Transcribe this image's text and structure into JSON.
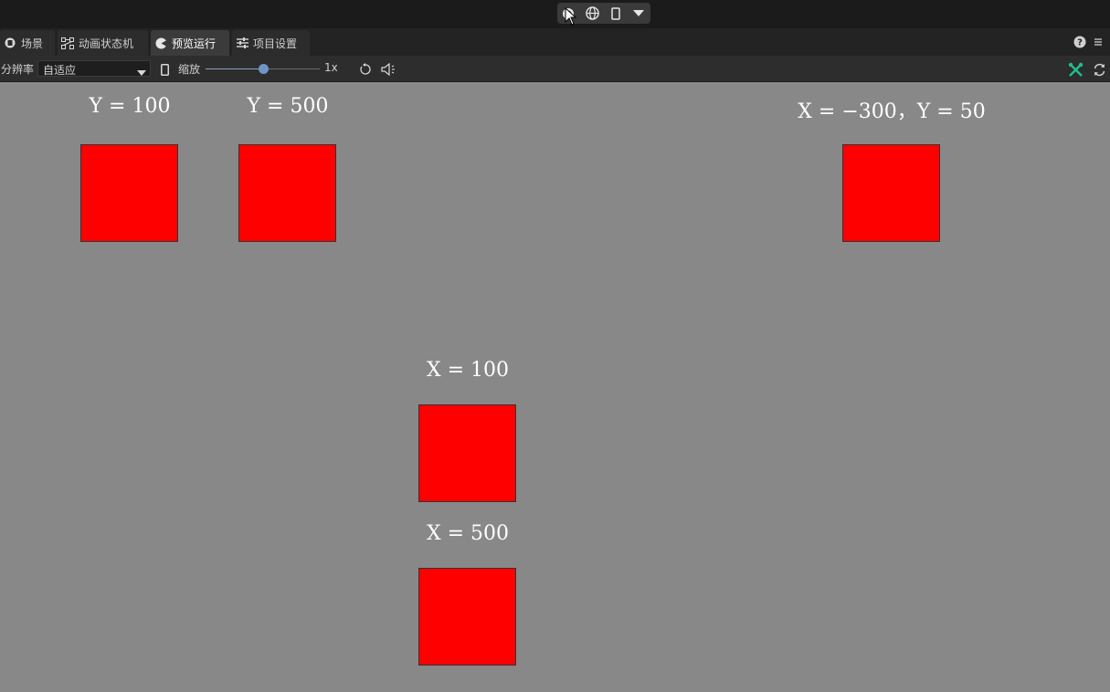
{
  "colors": {
    "canvas_bg": "#888888",
    "box_fill": "#ff0000",
    "label_text": "#ffffff",
    "accent_green": "#1fbf8f",
    "slider_thumb": "#6f95c7"
  },
  "top_controls": {
    "buttons": [
      "play-icon",
      "globe-icon",
      "mobile-device-icon",
      "dropdown-caret-icon"
    ]
  },
  "tabs": [
    {
      "label": "场景",
      "icon": "scene-icon",
      "active": false
    },
    {
      "label": "动画状态机",
      "icon": "state-machine-icon",
      "active": false
    },
    {
      "label": "预览运行",
      "icon": "preview-icon",
      "active": true
    },
    {
      "label": "项目设置",
      "icon": "settings-sliders-icon",
      "active": false
    }
  ],
  "toolbar": {
    "resolution_label": "分辨率",
    "resolution_value": "自适应",
    "zoom_label": "缩放",
    "zoom_value": "1x",
    "zoom_slider_fraction": 0.5
  },
  "canvas": {
    "labels": {
      "y100": "Y = 100",
      "y500": "Y = 500",
      "xy": "X = −300，Y = 50",
      "x100": "X = 100",
      "x500": "X = 500"
    }
  }
}
